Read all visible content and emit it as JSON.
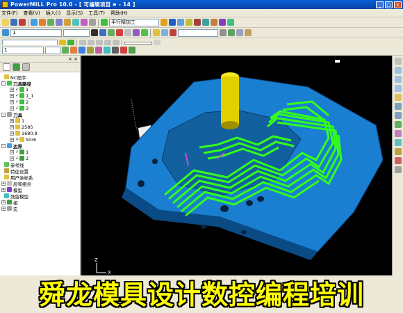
{
  "window": {
    "title": "PowerMILL Pro 10.0 - [ 可编辑项目 e - 14 ]"
  },
  "menu": [
    "文件(F)",
    "查看(V)",
    "插入(I)",
    "显示(S)",
    "工具(T)",
    "帮助(H)"
  ],
  "toolbar": {
    "strategy_select": "平行精加工",
    "row2_select_a": "1",
    "row4_select_a": "1"
  },
  "tree": {
    "items": [
      {
        "label": "NC程序"
      },
      {
        "label": "刀具路径"
      },
      {
        "label": "1"
      },
      {
        "label": "1_1"
      },
      {
        "label": "2"
      },
      {
        "label": "3"
      },
      {
        "label": "刀具"
      },
      {
        "label": "1"
      },
      {
        "label": "2585"
      },
      {
        "label": "1680.8"
      },
      {
        "label": "50r6"
      },
      {
        "label": "边界"
      },
      {
        "label": "1"
      },
      {
        "label": "2"
      },
      {
        "label": "参考线"
      },
      {
        "label": "特征设置"
      },
      {
        "label": "用户坐标系"
      },
      {
        "label": "层和组合"
      },
      {
        "label": "模型"
      },
      {
        "label": "残留模型"
      },
      {
        "label": "组"
      },
      {
        "label": "宏"
      }
    ]
  },
  "viewport": {
    "axis_z": "Z",
    "axis_x": "X"
  },
  "banner": {
    "text": "舜龙模具设计数控编程培训"
  },
  "colors": {
    "accent": "#0a5fd8",
    "model": "#1a7fd0",
    "toolpath": "#33ff1a",
    "tool": "#e8e000",
    "banner": "#ffff00"
  }
}
